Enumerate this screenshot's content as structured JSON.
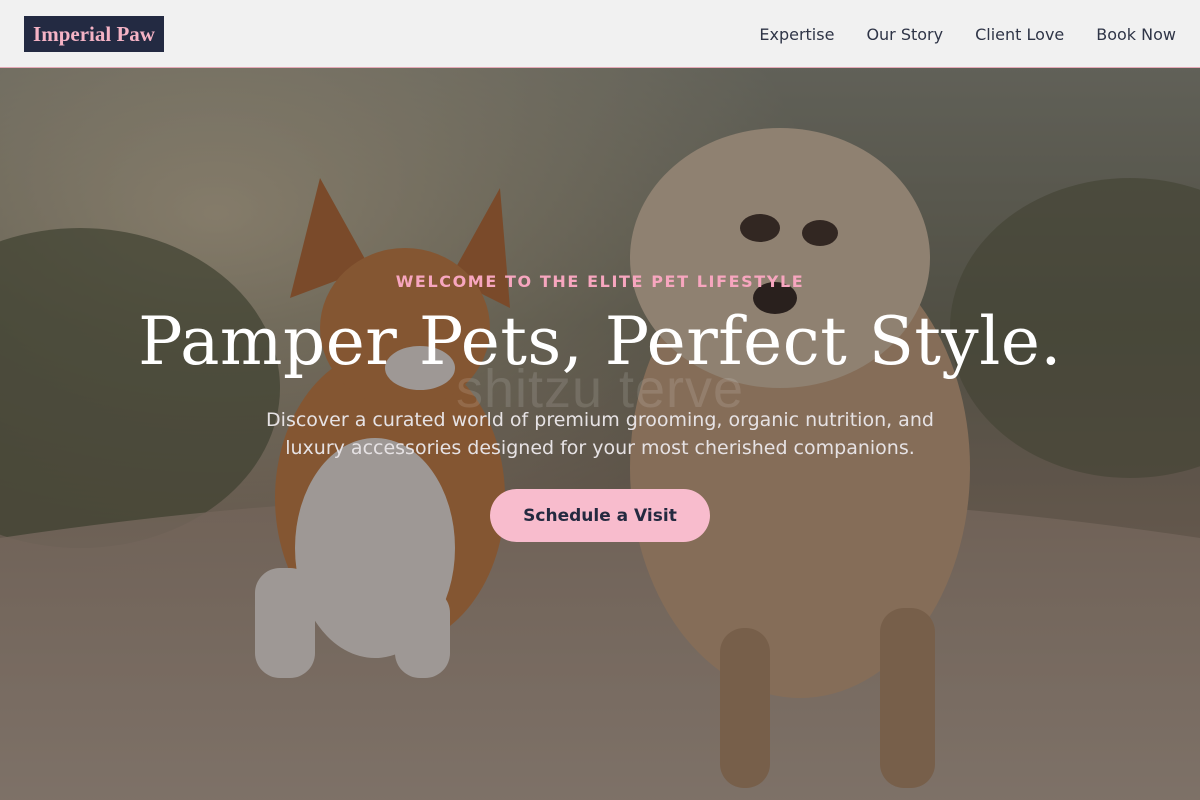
{
  "header": {
    "logo": "Imperial Paw",
    "nav": [
      {
        "label": "Expertise"
      },
      {
        "label": "Our Story"
      },
      {
        "label": "Client Love"
      },
      {
        "label": "Book Now"
      }
    ]
  },
  "hero": {
    "eyebrow": "WELCOME TO THE ELITE PET LIFESTYLE",
    "headline": "Pamper Pets, Perfect Style.",
    "subtext": "Discover a curated world of premium grooming, organic nutrition, and luxury accessories designed for your most cherished companions.",
    "cta_label": "Schedule a Visit",
    "watermark": "shitzu terve",
    "image_subject": "corgi-and-terrier-running-on-dirt-path"
  },
  "colors": {
    "accent_pink": "#f8bccd",
    "eyebrow_pink": "#f7a6bf",
    "logo_bg": "#232a42",
    "header_bg": "#f1f1f1",
    "nav_text": "#2f3547"
  }
}
